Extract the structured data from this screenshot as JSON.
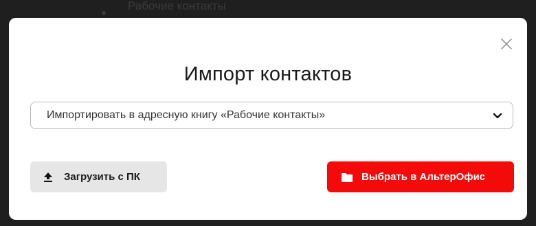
{
  "background": {
    "list_item_label": "Рабочие контакты",
    "list_item_icon": "contacts-icon"
  },
  "dialog": {
    "title": "Импорт контактов",
    "close_icon": "close-icon",
    "address_book_select": {
      "value": "Импортировать в адресную книгу «Рабочие контакты»",
      "icon": "chevron-down-icon"
    },
    "upload_button": {
      "label": "Загрузить с ПК",
      "icon": "upload-icon"
    },
    "choose_button": {
      "label": "Выбрать в АльтерОфис",
      "icon": "folder-icon"
    }
  },
  "colors": {
    "accent": "#f50a0a",
    "secondary_button": "#e6e6e6",
    "overlay": "#1f1f1f"
  }
}
